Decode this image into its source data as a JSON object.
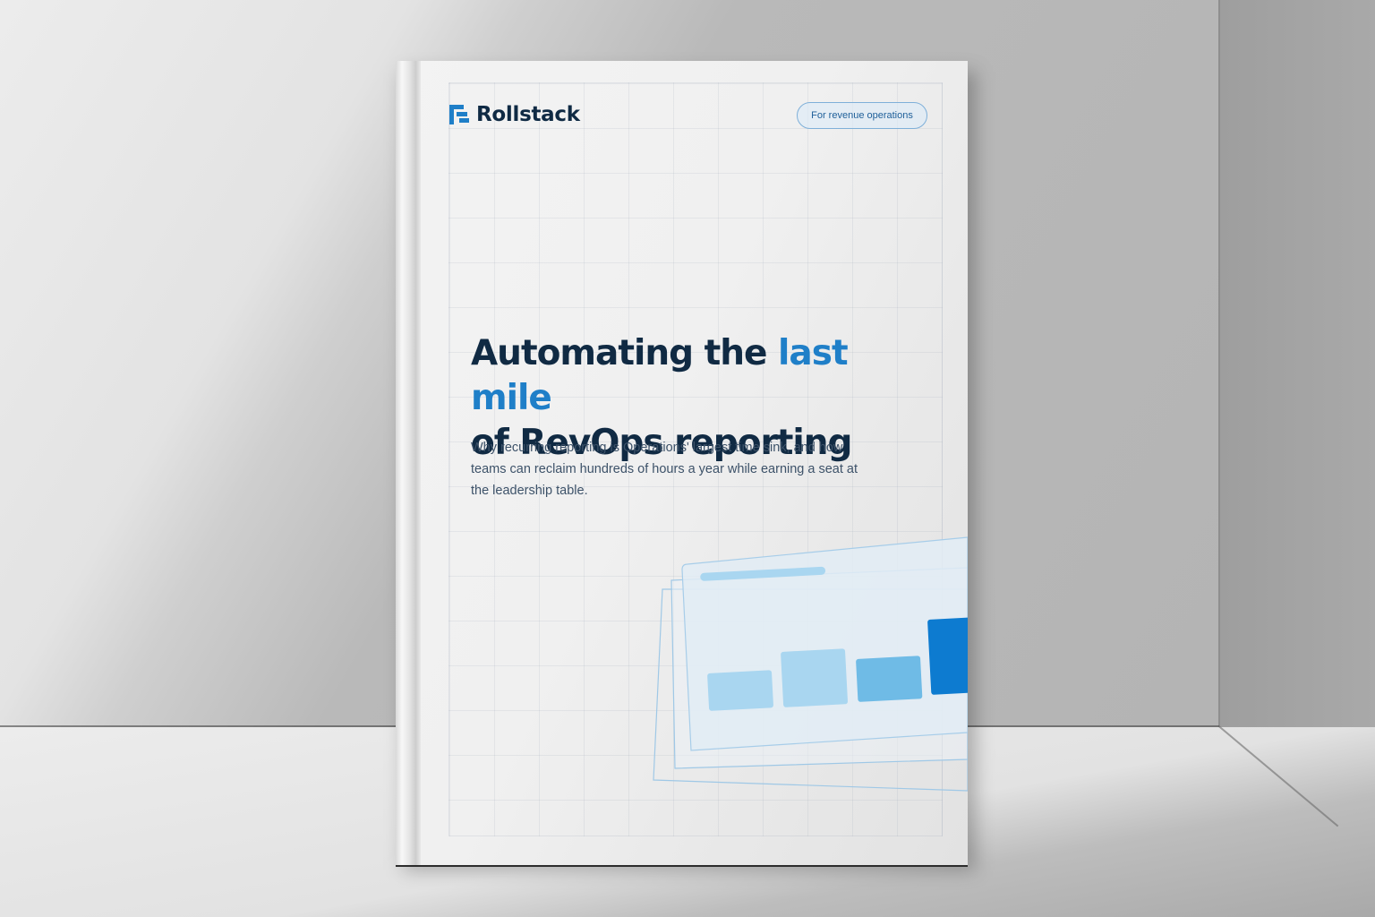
{
  "cover": {
    "brand": "Rollstack",
    "tag": "For revenue operations",
    "title_part1": "Automating the ",
    "title_accent": "last mile",
    "title_part2": "of RevOps reporting",
    "subtitle": "Why recurring reporting is Operations' largest time sink, and how teams can reclaim hundreds of hours a year while earning a seat at the leadership table."
  },
  "colors": {
    "brand_navy": "#102a43",
    "accent_blue": "#1f7fc8",
    "light_blue": "#a9d6f0",
    "bar_dark": "#0d7bd0"
  },
  "icons": {
    "logo": "rollstack-logo-icon"
  }
}
